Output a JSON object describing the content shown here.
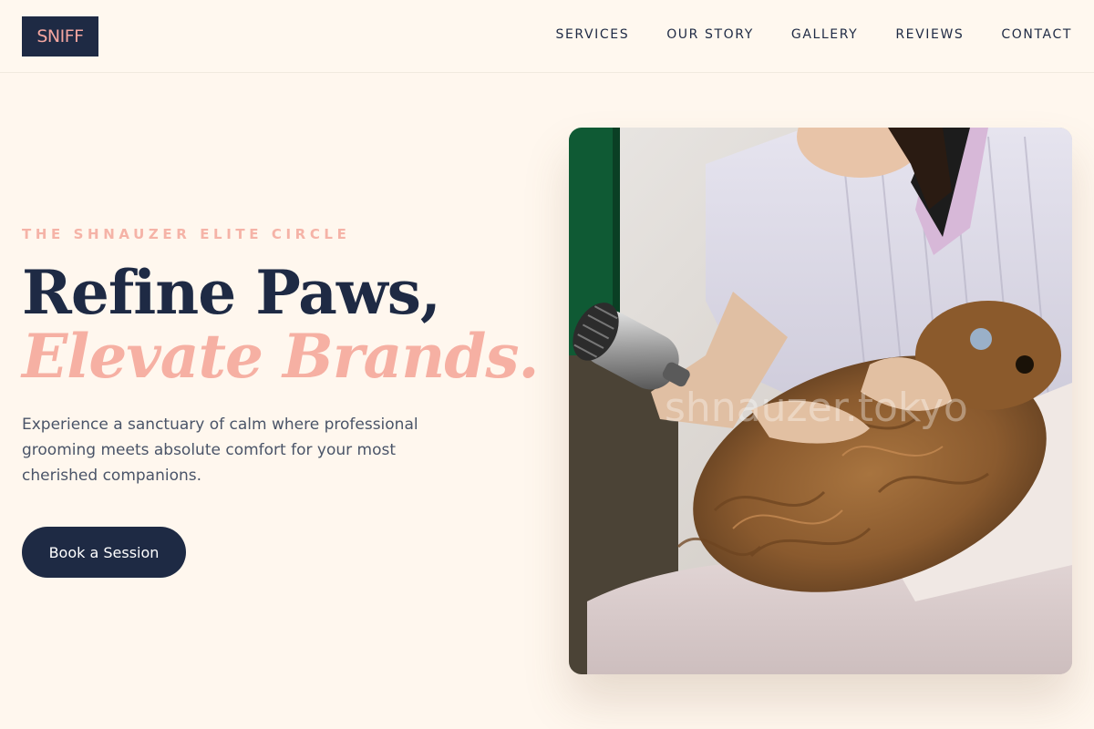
{
  "brand": {
    "logo_text": "SNIFF",
    "colors": {
      "navy": "#1e2a44",
      "accent_pink": "#f5b3a7",
      "background": "#fff7ee"
    }
  },
  "nav": {
    "items": [
      {
        "label": "SERVICES"
      },
      {
        "label": "OUR STORY"
      },
      {
        "label": "GALLERY"
      },
      {
        "label": "REVIEWS"
      },
      {
        "label": "CONTACT"
      }
    ]
  },
  "hero": {
    "eyebrow": "THE SHNAUZER ELITE CIRCLE",
    "headline_line1": "Refine Paws,",
    "headline_line2": "Elevate Brands.",
    "description": "Experience a sanctuary of calm where professional grooming meets absolute comfort for your most cherished companions.",
    "cta_label": "Book a Session",
    "image": {
      "subject": "groomer-blow-drying-dog-photo",
      "watermark": "shnauzer.tokyo"
    }
  }
}
